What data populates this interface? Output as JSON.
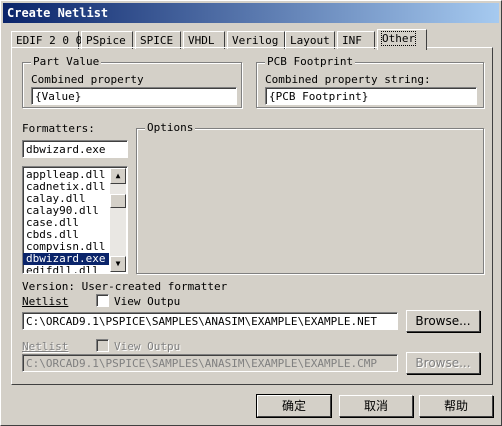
{
  "window": {
    "title": "Create Netlist"
  },
  "tabs": [
    "EDIF 2 0 0",
    "PSpice",
    "SPICE",
    "VHDL",
    "Verilog",
    "Layout",
    "INF",
    "Other"
  ],
  "part_value": {
    "group_label": "Part Value",
    "field_label": "Combined property",
    "value": "{Value}"
  },
  "pcb_footprint": {
    "group_label": "PCB Footprint",
    "field_label": "Combined property string:",
    "value": "{PCB Footprint}"
  },
  "formatters": {
    "label": "Formatters:",
    "value": "dbwizard.exe",
    "items": [
      "applleap.dll",
      "cadnetix.dll",
      "calay.dll",
      "calay90.dll",
      "case.dll",
      "cbds.dll",
      "compvisn.dll",
      "dbwizard.exe",
      "edifdll.dll"
    ],
    "selected_index": 7
  },
  "options": {
    "label": "Options"
  },
  "version": {
    "text": "Version: User-created formatter"
  },
  "netlist": {
    "label": "Netlist",
    "view_output_label": "View Outpu",
    "value": "C:\\ORCAD9.1\\PSPICE\\SAMPLES\\ANASIM\\EXAMPLE\\EXAMPLE.NET",
    "browse_label": "Browse..."
  },
  "netlist2": {
    "label": "Netlist",
    "view_output_label": "View Outpu",
    "value": "C:\\ORCAD9.1\\PSPICE\\SAMPLES\\ANASIM\\EXAMPLE\\EXAMPLE.CMP",
    "browse_label": "Browse..."
  },
  "buttons": {
    "ok": "确定",
    "cancel": "取消",
    "help": "帮助"
  }
}
